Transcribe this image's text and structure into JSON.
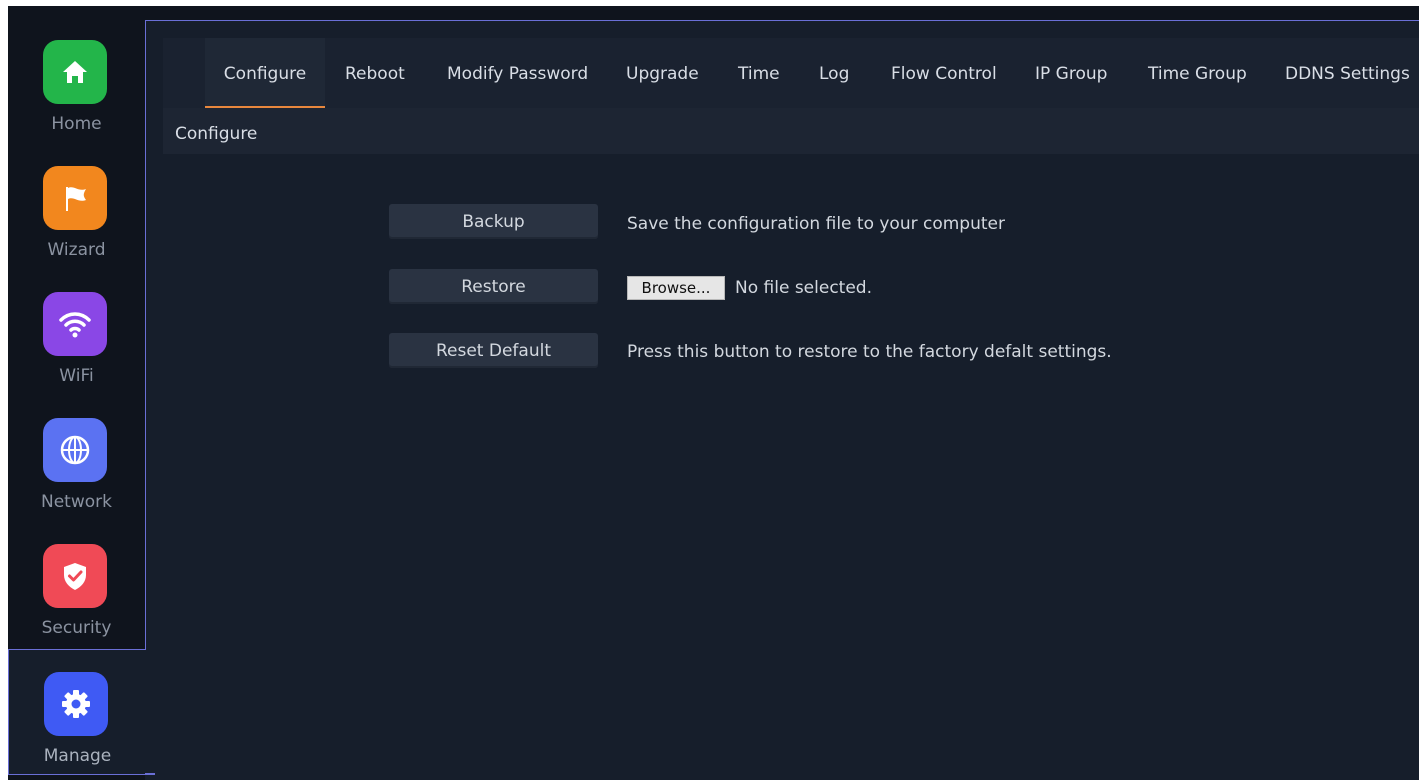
{
  "sidebar": {
    "items": [
      {
        "label": "Home",
        "icon": "home-icon",
        "color": "#23b54a"
      },
      {
        "label": "Wizard",
        "icon": "flag-icon",
        "color": "#f2871e"
      },
      {
        "label": "WiFi",
        "icon": "wifi-icon",
        "color": "#8a47e6"
      },
      {
        "label": "Network",
        "icon": "globe-icon",
        "color": "#5b72f2"
      },
      {
        "label": "Security",
        "icon": "shield-icon",
        "color": "#f04a56"
      },
      {
        "label": "Manage",
        "icon": "gear-icon",
        "color": "#3f5af4"
      }
    ],
    "active": "Manage"
  },
  "tabs": [
    "Configure",
    "Reboot",
    "Modify Password",
    "Upgrade",
    "Time",
    "Log",
    "Flow Control",
    "IP Group",
    "Time Group",
    "DDNS Settings"
  ],
  "active_tab": "Configure",
  "breadcrumb": "Configure",
  "actions": {
    "backup": {
      "label": "Backup",
      "description": "Save the configuration file to your computer"
    },
    "restore": {
      "label": "Restore",
      "browse_label": "Browse...",
      "file_status": "No file selected."
    },
    "reset": {
      "label": "Reset Default",
      "description": "Press this button to restore to the factory defalt settings."
    }
  },
  "colors": {
    "accent_tab_underline": "#e8873d",
    "active_border": "#6a6fd6",
    "background": "#161e2b"
  }
}
